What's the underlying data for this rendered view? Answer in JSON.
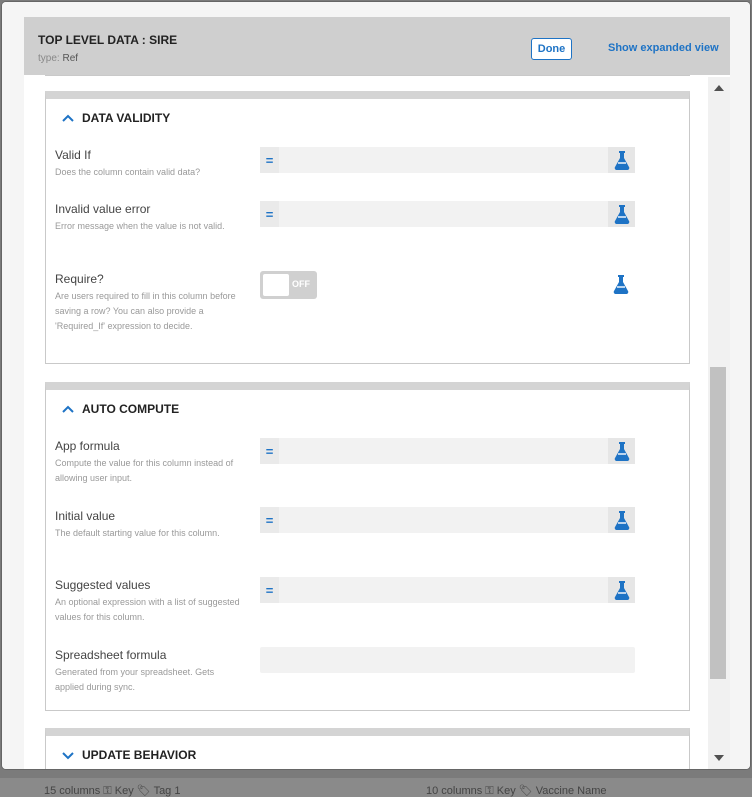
{
  "dialog": {
    "title": "TOP LEVEL DATA : SIRE",
    "type_key": "type:",
    "type_value": "Ref",
    "done_label": "Done",
    "expand_label": "Show expanded view"
  },
  "sections": {
    "data_validity": {
      "title": "DATA VALIDITY",
      "valid_if": {
        "label": "Valid If",
        "help": "Does the column contain valid data?",
        "value": ""
      },
      "invalid_error": {
        "label": "Invalid value error",
        "help": "Error message when the value is not valid.",
        "value": ""
      },
      "require": {
        "label": "Require?",
        "help": "Are users required to fill in this column before saving a row? You can also provide a 'Required_If' expression to decide.",
        "toggle": "OFF"
      }
    },
    "auto_compute": {
      "title": "AUTO COMPUTE",
      "app_formula": {
        "label": "App formula",
        "help": "Compute the value for this column instead of allowing user input.",
        "value": ""
      },
      "initial_value": {
        "label": "Initial value",
        "help": "The default starting value for this column.",
        "value": ""
      },
      "suggested_values": {
        "label": "Suggested values",
        "help": "An optional expression with a list of suggested values for this column.",
        "value": ""
      },
      "spreadsheet_formula": {
        "label": "Spreadsheet formula",
        "help": "Generated from your spreadsheet. Gets applied during sync.",
        "value": ""
      }
    },
    "update_behavior": {
      "title": "UPDATE BEHAVIOR"
    }
  },
  "expr_symbol": "=",
  "backdrop": {
    "left_footer": "15 columns   ⚿ Key   🏷 Tag 1",
    "right_footer": "10 columns   ⚿ Key   🏷 Vaccine Name"
  },
  "colors": {
    "accent": "#1e73c5",
    "header_bg": "#cfcfcf"
  }
}
